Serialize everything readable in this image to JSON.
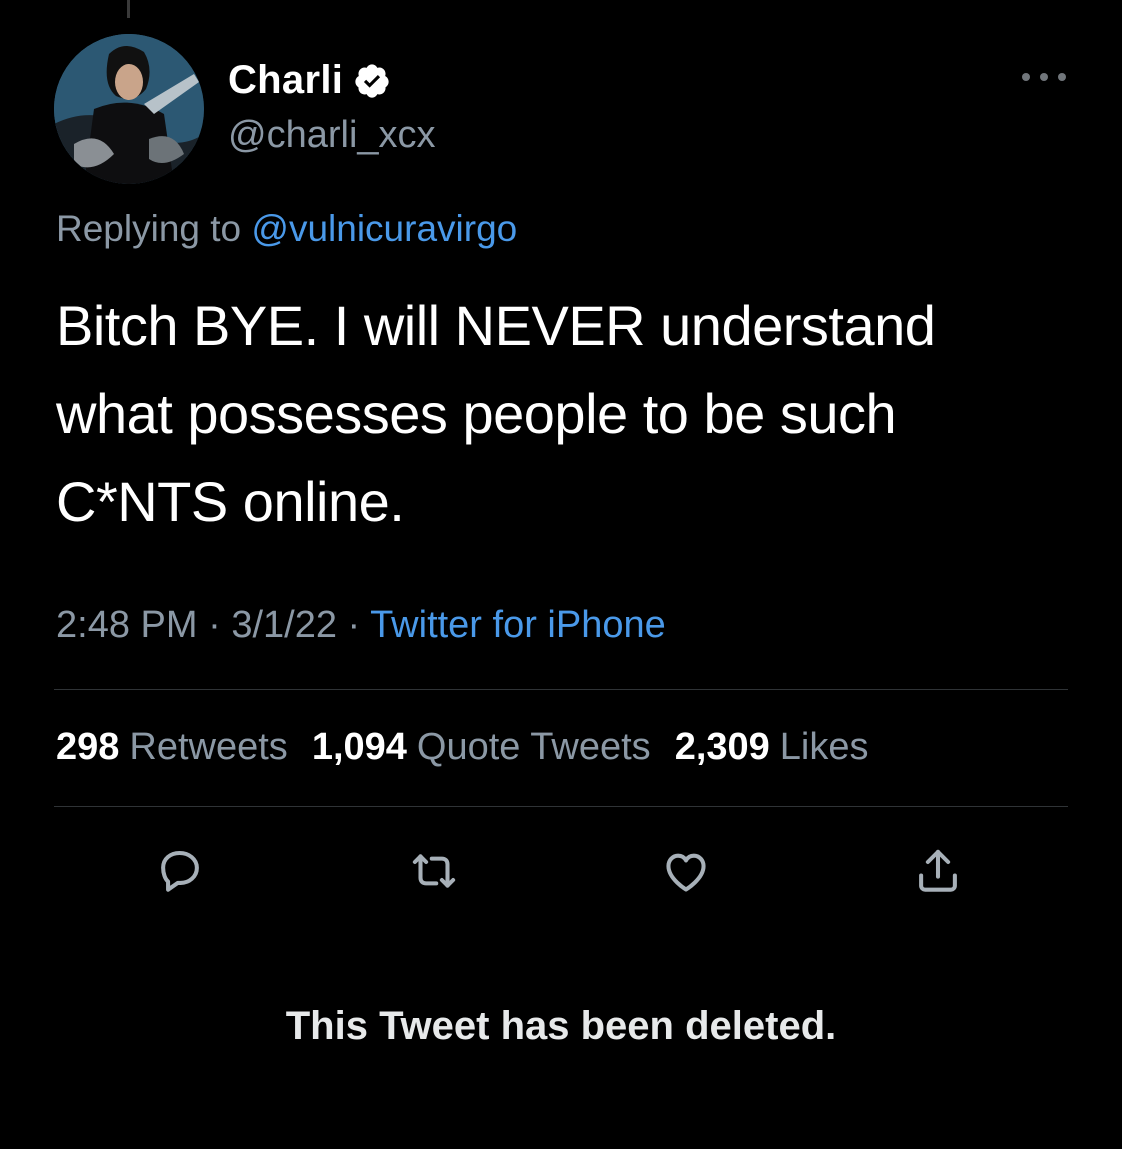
{
  "tweet": {
    "display_name": "Charli",
    "handle": "@charli_xcx",
    "replying_prefix": "Replying to",
    "replying_to": "@vulnicuravirgo",
    "text": "Bitch BYE. I will NEVER understand what possesses people to be such C*NTS online.",
    "time": "2:48 PM",
    "date": "3/1/22",
    "separator": "·",
    "source": "Twitter for iPhone"
  },
  "stats": {
    "retweets_count": "298",
    "retweets_label": "Retweets",
    "quotes_count": "1,094",
    "quotes_label": "Quote Tweets",
    "likes_count": "2,309",
    "likes_label": "Likes"
  },
  "icons": {
    "verified": "verified-badge-icon",
    "more": "more-dots-icon",
    "reply": "reply-bubble-icon",
    "retweet": "retweet-arrows-icon",
    "like": "heart-icon",
    "share": "share-upload-icon"
  },
  "colors": {
    "background": "#000000",
    "text": "#ffffff",
    "secondary": "#8b98a5",
    "link": "#4a99e9",
    "divider": "#2f3336"
  },
  "notice": {
    "deleted_text": "This Tweet has been deleted."
  }
}
